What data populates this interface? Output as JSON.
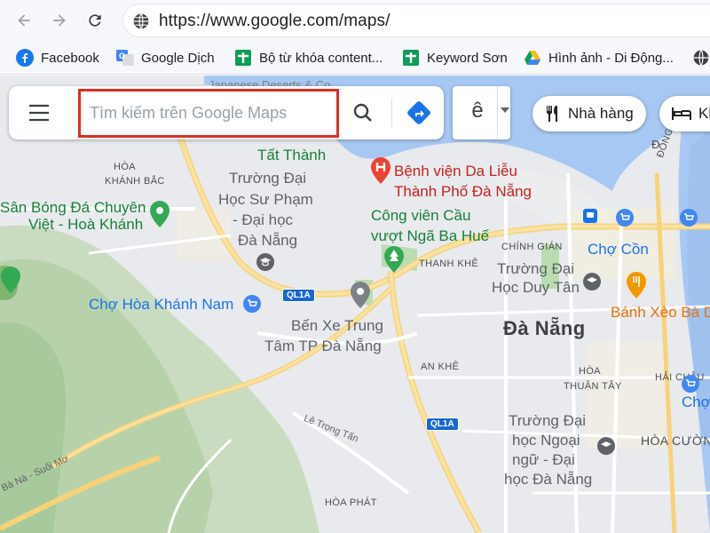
{
  "browser": {
    "url": "https://www.google.com/maps/",
    "bookmarks": [
      {
        "label": "Facebook",
        "icon": "facebook-icon"
      },
      {
        "label": "Google Dịch",
        "icon": "google-translate-icon"
      },
      {
        "label": "Bộ từ khóa content...",
        "icon": "google-sheets-icon"
      },
      {
        "label": "Keyword Sơn",
        "icon": "google-sheets-icon"
      },
      {
        "label": "Hình ảnh - Di Động...",
        "icon": "google-drive-icon"
      }
    ]
  },
  "maps": {
    "search": {
      "placeholder": "Tìm kiếm trên Google Maps",
      "value": ""
    },
    "input_tool_char": "ê",
    "chips": [
      {
        "label": "Nhà hàng",
        "icon": "restaurant-icon"
      },
      {
        "label": "Kh",
        "icon": "hotel-icon"
      }
    ]
  },
  "map_labels": {
    "japanese_deserts": "Japanese Deserts & Co...",
    "tat_thanh": "Tất Thành",
    "hoa": "HÒA",
    "khanh_bac": "KHÁNH BẮC",
    "benh_vien_1": "Bệnh viện Da Liễu",
    "benh_vien_2": "Thành Phố Đà Nẵng",
    "truong_su_pham_1": "Trường Đại",
    "truong_su_pham_2": "Học Sư Phạm",
    "truong_su_pham_3": "- Đại học",
    "truong_su_pham_4": "Đà Nẵng",
    "san_bong_1": "Sân Bóng Đá Chuyên",
    "san_bong_2": "Việt - Hoà Khánh",
    "cong_vien_1": "Công viên Cầu",
    "cong_vien_2": "vượt Ngã Ba Huế",
    "chinh_gian": "CHÍNH GIÁN",
    "thanh_khe": "THANH KHÊ",
    "cho_con": "Chợ Cồn",
    "duy_tan_1": "Trường Đại",
    "duy_tan_2": "Học Duy Tân",
    "cho_hoa_khanh": "Chợ Hòa Khánh Nam",
    "ben_xe_1": "Bến Xe Trung",
    "ben_xe_2": "Tâm TP Đà Nẵng",
    "da_nang": "Đà Nẵng",
    "banh_xeo": "Bánh Xèo Bà D",
    "an_khe": "AN KHÊ",
    "hoa_thuan_1": "HÒA",
    "hoa_thuan_2": "THUẬN TÂY",
    "hai_chau": "HẢI CHÂU",
    "le_trong_tan": "Lê Trọng Tấn",
    "ngoai_ngu_1": "Trường Đại",
    "ngoai_ngu_2": "học Ngoại",
    "ngoai_ngu_3": "ngữ - Đại",
    "ngoai_ngu_4": "học Đà Nẵng",
    "hoa_cuong": "HÒA CƯỜN",
    "cho_right": "Chợ",
    "dong_da": "ĐỐNG ĐA",
    "ba_na": "Bà Nà - Suối Mơ",
    "hoa_phat": "HÒA PHÁT",
    "ql1a_1": "QL1A",
    "ql1a_2": "QL1A",
    "d_label": "Đ"
  }
}
